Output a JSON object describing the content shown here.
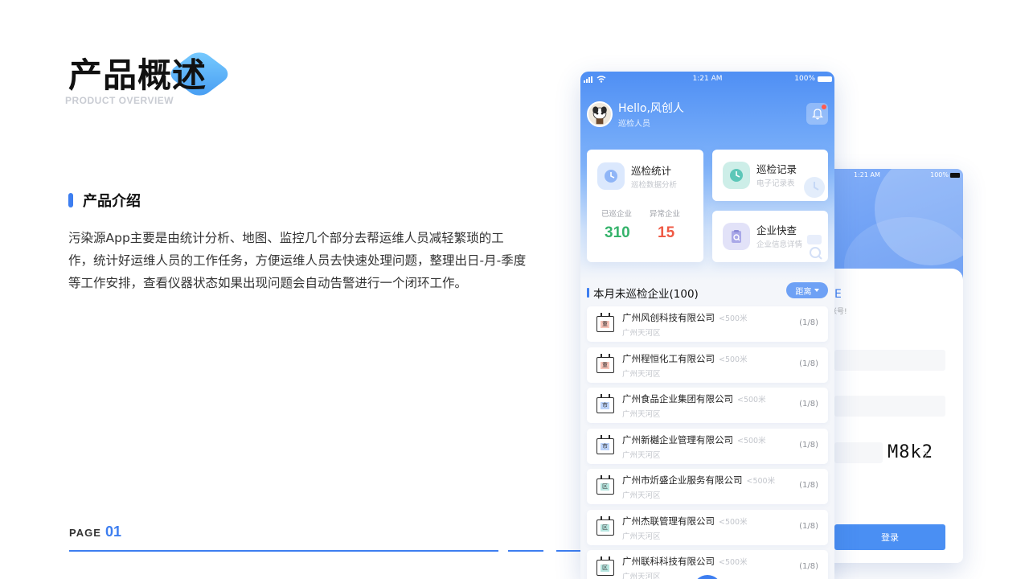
{
  "slide": {
    "title": "产品概述",
    "subtitle": "PRODUCT OVERVIEW",
    "section_title": "产品介绍",
    "intro": "污染源App主要是由统计分析、地图、监控几个部分去帮运维人员减轻繁琐的工作，统计好运维人员的工作任务，方便运维人员去快速处理问题，整理出日-月-季度等工作安排，查看仪器状态如果出现问题会自动告警进行一个闭环工作。",
    "page_label": "PAGE",
    "page_number": "01",
    "accent_color": "#3d7ef0"
  },
  "login_phone": {
    "status_time": "1:21 AM",
    "status_battery": "100%",
    "hint_title": "E",
    "hint_text": "账号!",
    "captcha": "M8k2",
    "login_label": "登录"
  },
  "home_phone": {
    "status_time": "1:21 AM",
    "status_battery": "100%",
    "greeting": "Hello,风创人",
    "role": "巡检人员",
    "cards": {
      "stats": {
        "title": "巡检统计",
        "subtitle": "巡检数据分析",
        "inspected_label": "已巡企业",
        "inspected_value": "310",
        "abnormal_label": "异常企业",
        "abnormal_value": "15"
      },
      "records": {
        "title": "巡检记录",
        "subtitle": "电子记录表"
      },
      "lookup": {
        "title": "企业快查",
        "subtitle": "企业信息详情"
      }
    },
    "list_title": "本月未巡检企业(100)",
    "sort_label": "距离",
    "companies": [
      {
        "tag": "重",
        "tag_color": "#f7c3b8",
        "name": "广州风创科技有限公司",
        "distance": "<500米",
        "area": "广州天河区",
        "progress": "(1/8)"
      },
      {
        "tag": "重",
        "tag_color": "#f7c3b8",
        "name": "广州程恒化工有限公司",
        "distance": "<500米",
        "area": "广州天河区",
        "progress": "(1/8)"
      },
      {
        "tag": "市",
        "tag_color": "#bcd3fa",
        "name": "广州食品企业集团有限公司",
        "distance": "<500米",
        "area": "广州天河区",
        "progress": "(1/8)"
      },
      {
        "tag": "市",
        "tag_color": "#bcd3fa",
        "name": "广州新樾企业管理有限公司",
        "distance": "<500米",
        "area": "广州天河区",
        "progress": "(1/8)"
      },
      {
        "tag": "区",
        "tag_color": "#b7e6e0",
        "name": "广州市炘盛企业服务有限公司",
        "distance": "<500米",
        "area": "广州天河区",
        "progress": "(1/8)"
      },
      {
        "tag": "区",
        "tag_color": "#b7e6e0",
        "name": "广州杰联管理有限公司",
        "distance": "<500米",
        "area": "广州天河区",
        "progress": "(1/8)"
      },
      {
        "tag": "区",
        "tag_color": "#b7e6e0",
        "name": "广州联科科技有限公司",
        "distance": "<500米",
        "area": "广州天河区",
        "progress": "(1/8)"
      }
    ]
  }
}
